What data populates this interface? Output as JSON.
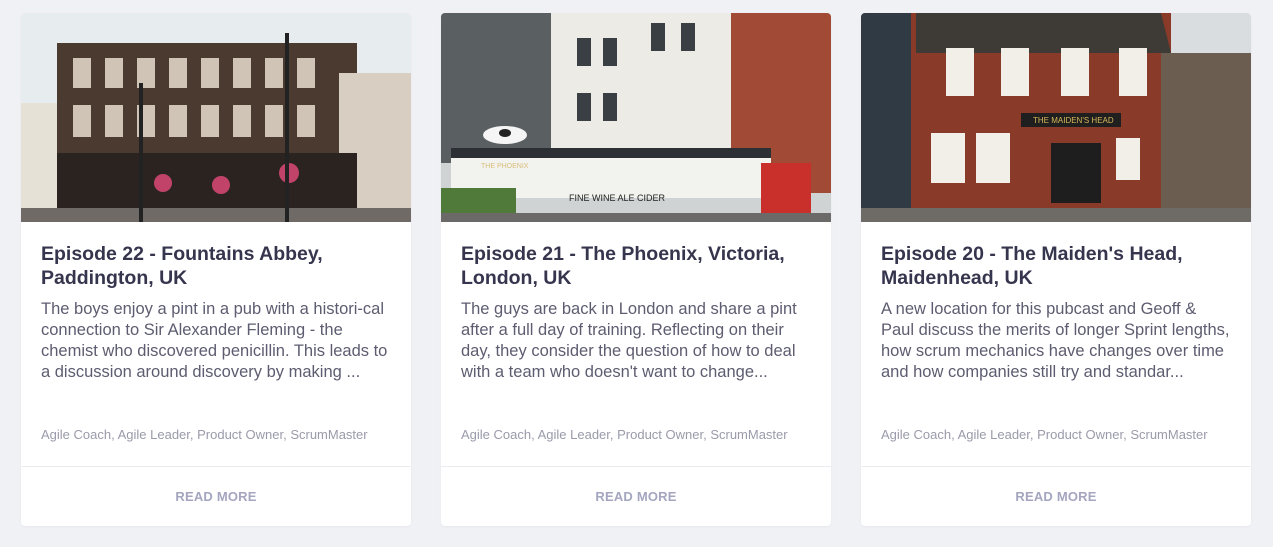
{
  "episodes": [
    {
      "title": "Episode 22 - Fountains Abbey, Paddington, UK",
      "excerpt": "The boys enjoy a pint in a pub with a histori-cal connection to Sir Alexander Fleming - the chemist who discovered penicillin. This leads to a discussion around discovery by making ...",
      "tags": "Agile Coach, Agile Leader, Product Owner, ScrumMaster",
      "read_more": "READ MORE"
    },
    {
      "title": "Episode 21 - The Phoenix, Victoria, London, UK",
      "excerpt": "The guys are back in London and share a pint after a full day of training. Reflecting on their day, they consider the question of how to deal with a team who doesn't want to change...",
      "tags": "Agile Coach, Agile Leader, Product Owner, ScrumMaster",
      "read_more": "READ MORE",
      "photo_text": {
        "pub_name": "THE PHOENIX",
        "sign": "FINE WINE  ALE  CIDER"
      }
    },
    {
      "title": "Episode 20 - The Maiden's Head, Maidenhead, UK",
      "excerpt": "A new location for this pubcast and Geoff & Paul discuss the merits of longer Sprint lengths, how scrum mechanics have changes over time and how companies still try and standar...",
      "tags": "Agile Coach, Agile Leader, Product Owner, ScrumMaster",
      "read_more": "READ MORE",
      "photo_text": {
        "pub_name": "THE MAIDEN'S HEAD"
      }
    }
  ],
  "colors": {
    "background": "#f0f1f5",
    "card": "#ffffff",
    "title": "#36354e",
    "excerpt": "#5d5c70",
    "tags": "#9a9aaa",
    "read_more": "#a4a6bf"
  }
}
